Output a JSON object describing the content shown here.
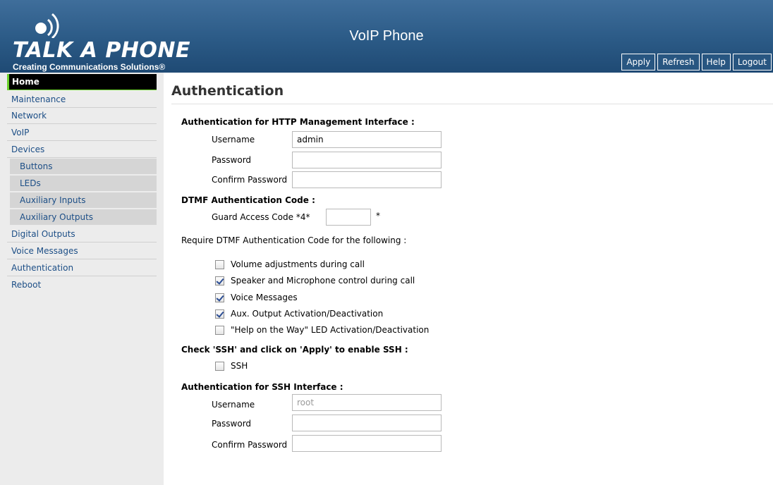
{
  "header": {
    "logo_text": "TALK A PHONE",
    "logo_tagline": "Creating Communications Solutions®",
    "title": "VoIP Phone",
    "buttons": [
      "Apply",
      "Refresh",
      "Help",
      "Logout"
    ]
  },
  "sidebar": {
    "items": [
      {
        "label": "Home",
        "active": true,
        "sub": false
      },
      {
        "label": "Maintenance",
        "active": false,
        "sub": false
      },
      {
        "label": "Network",
        "active": false,
        "sub": false
      },
      {
        "label": "VoIP",
        "active": false,
        "sub": false
      },
      {
        "label": "Devices",
        "active": false,
        "sub": false
      },
      {
        "label": "Buttons",
        "active": false,
        "sub": true
      },
      {
        "label": "LEDs",
        "active": false,
        "sub": true
      },
      {
        "label": "Auxiliary Inputs",
        "active": false,
        "sub": true
      },
      {
        "label": "Auxiliary Outputs",
        "active": false,
        "sub": true
      },
      {
        "label": "Digital Outputs",
        "active": false,
        "sub": false
      },
      {
        "label": "Voice Messages",
        "active": false,
        "sub": false
      },
      {
        "label": "Authentication",
        "active": false,
        "sub": false
      },
      {
        "label": "Reboot",
        "active": false,
        "sub": false
      }
    ]
  },
  "main": {
    "title": "Authentication",
    "http": {
      "heading": "Authentication for HTTP Management Interface :",
      "username_label": "Username",
      "username_value": "admin",
      "password_label": "Password",
      "confirm_label": "Confirm Password"
    },
    "dtmf": {
      "heading": "DTMF Authentication Code :",
      "guard_label": "Guard Access Code *4*",
      "guard_suffix": "*",
      "require_text": "Require DTMF Authentication Code for the following :",
      "options": [
        {
          "label": "Volume adjustments during call",
          "checked": false
        },
        {
          "label": "Speaker and Microphone control during call",
          "checked": true
        },
        {
          "label": "Voice Messages",
          "checked": true
        },
        {
          "label": "Aux. Output Activation/Deactivation",
          "checked": true
        },
        {
          "label": "\"Help on the Way\" LED Activation/Deactivation",
          "checked": false
        }
      ]
    },
    "ssh_enable": {
      "heading": "Check 'SSH' and click on 'Apply' to enable SSH :",
      "checkbox_label": "SSH",
      "checked": false
    },
    "ssh": {
      "heading": "Authentication for SSH Interface :",
      "username_label": "Username",
      "username_value": "root",
      "password_label": "Password",
      "confirm_label": "Confirm Password"
    }
  }
}
